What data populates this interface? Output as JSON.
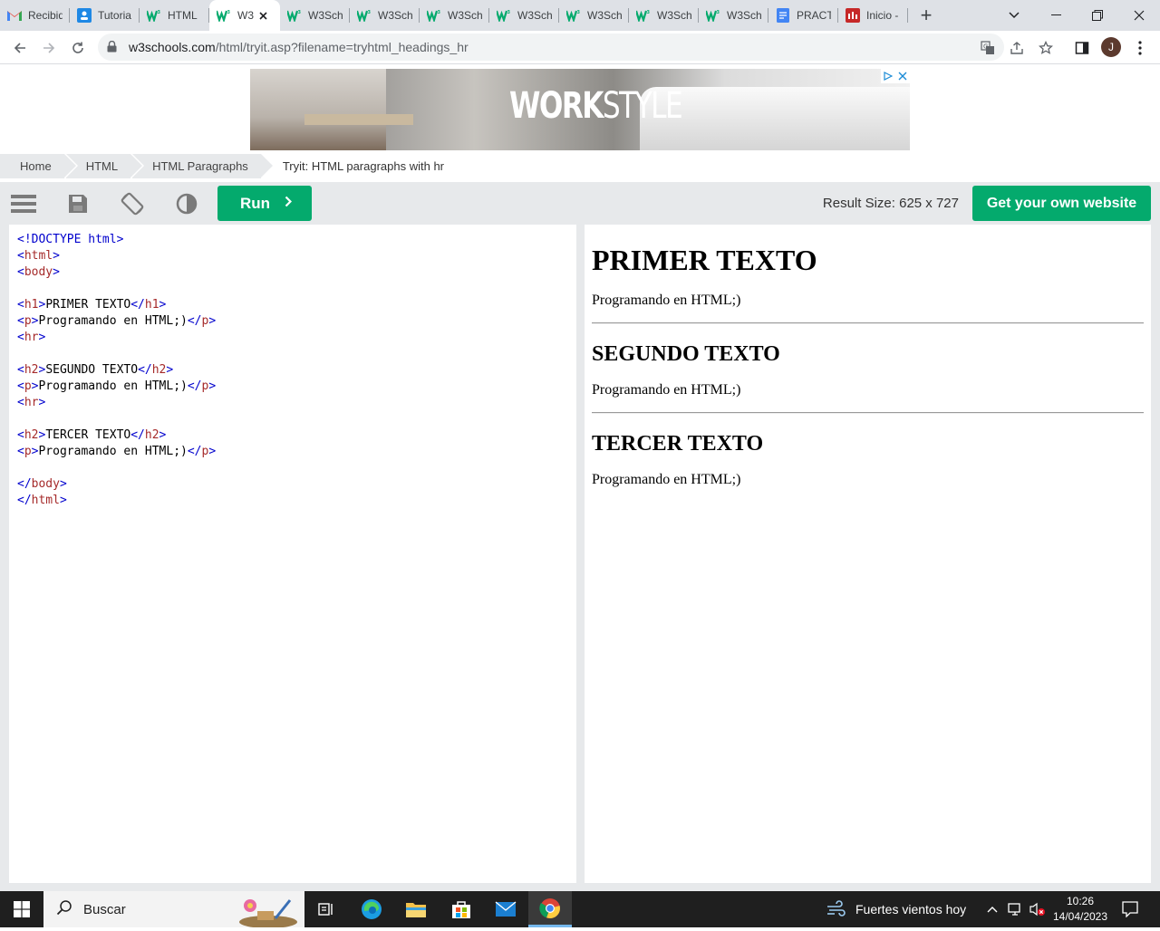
{
  "browser": {
    "tabs": [
      {
        "icon": "gmail-icon",
        "label": "Recibid"
      },
      {
        "icon": "classroom-icon",
        "label": "Tutoria"
      },
      {
        "icon": "w3schools-icon",
        "label": "HTML"
      },
      {
        "icon": "w3schools-icon",
        "label": "W3",
        "active": true
      },
      {
        "icon": "w3schools-icon",
        "label": "W3Sch"
      },
      {
        "icon": "w3schools-icon",
        "label": "W3Sch"
      },
      {
        "icon": "w3schools-icon",
        "label": "W3Sch"
      },
      {
        "icon": "w3schools-icon",
        "label": "W3Sch"
      },
      {
        "icon": "w3schools-icon",
        "label": "W3Sch"
      },
      {
        "icon": "w3schools-icon",
        "label": "W3Sch"
      },
      {
        "icon": "w3schools-icon",
        "label": "W3Sch"
      },
      {
        "icon": "docs-icon",
        "label": "PRACT"
      },
      {
        "icon": "inicio-icon",
        "label": "Inicio -"
      }
    ],
    "url_host": "w3schools.com",
    "url_path": "/html/tryit.asp?filename=tryhtml_headings_hr",
    "profile_initial": "J"
  },
  "ad": {
    "logo_bold": "WORK",
    "logo_light": "STYLE"
  },
  "breadcrumb": {
    "items": [
      "Home",
      "HTML",
      "HTML Paragraphs"
    ],
    "current": "Tryit: HTML paragraphs with hr"
  },
  "tryit": {
    "run_label": "Run",
    "result_size": "Result Size: 625 x 727",
    "get_website": "Get your own website"
  },
  "code": {
    "lines": [
      "<!DOCTYPE html>",
      "<html>",
      "<body>",
      "",
      "<h1>PRIMER TEXTO</h1>",
      "<p>Programando en HTML;)</p>",
      "<hr>",
      "",
      "<h2>SEGUNDO TEXTO</h2>",
      "<p>Programando en HTML;)</p>",
      "<hr>",
      "",
      "<h2>TERCER TEXTO</h2>",
      "<p>Programando en HTML;)</p>",
      "",
      "</body>",
      "</html>"
    ]
  },
  "result": {
    "h1": "PRIMER TEXTO",
    "p1": "Programando en HTML;)",
    "h2a": "SEGUNDO TEXTO",
    "p2": "Programando en HTML;)",
    "h2b": "TERCER TEXTO",
    "p3": "Programando en HTML;)"
  },
  "taskbar": {
    "search_placeholder": "Buscar",
    "weather": "Fuertes vientos hoy",
    "time": "10:26",
    "date": "14/04/2023"
  },
  "colors": {
    "accent_green": "#04aa6d",
    "tab_strip": "#dee1e6",
    "panel_gray": "#e7e9eb"
  }
}
